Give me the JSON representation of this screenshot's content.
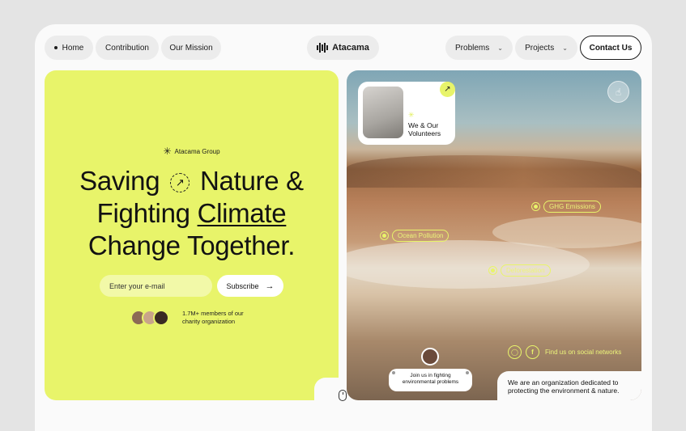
{
  "nav": {
    "left_items": [
      "Home",
      "Contribution",
      "Our Mission"
    ],
    "logo": "Atacama",
    "dropdowns": [
      "Problems",
      "Projects"
    ],
    "contact": "Contact Us"
  },
  "hero": {
    "brand_tag": "Atacama Group",
    "line1a": "Saving",
    "line1b": "Nature &",
    "line2a": "Fighting",
    "line2b": "Climate",
    "line3": "Change Together.",
    "email_placeholder": "Enter your e-mail",
    "subscribe": "Subscribe",
    "members_line1": "1.7M+  members of our",
    "members_line2": "charity organization"
  },
  "visual": {
    "volunteer_line1": "We & Our",
    "volunteer_line2": "Volunteers",
    "tags": [
      "GHG Emissions",
      "Ocean Pollution",
      "Deforestation"
    ],
    "social_label": "Find us on social networks",
    "join_line1": "Join us in fighting",
    "join_line2": "environmental problems",
    "mission_line1": "We are an organization dedicated to",
    "mission_line2": "protecting the environment & nature."
  },
  "colors": {
    "accent": "#e8f46a",
    "dark": "#161616",
    "page": "#fafafa"
  },
  "icons": [
    "logo-mark-icon",
    "chevron-down-icon",
    "asterisk-icon",
    "arrow-up-right-icon",
    "arrow-right-icon",
    "hand-pointer-icon",
    "instagram-icon",
    "facebook-icon",
    "mouse-scroll-icon"
  ]
}
